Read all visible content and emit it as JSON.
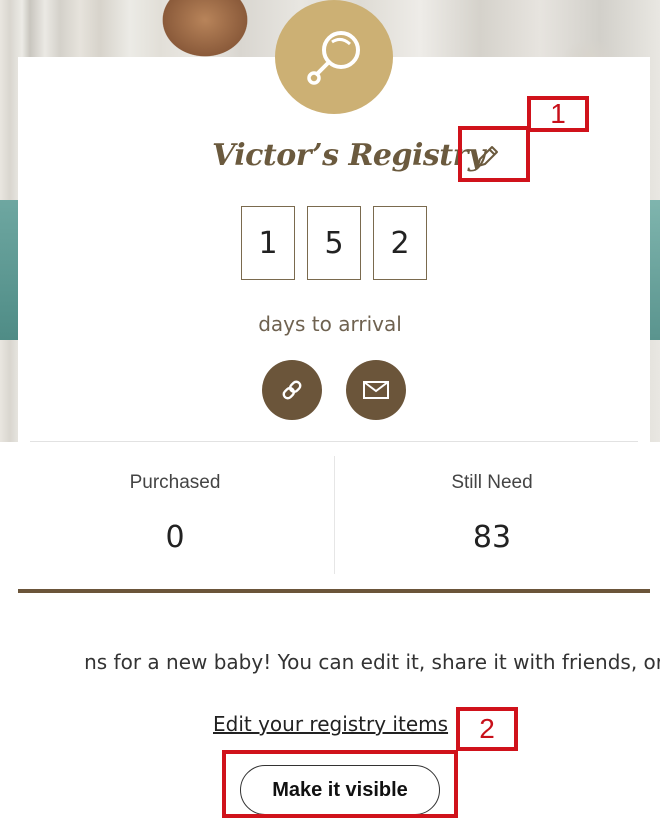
{
  "registry": {
    "title": "Victor’s Registry",
    "countdown_digits": [
      "1",
      "5",
      "2"
    ],
    "countdown_label": "days to arrival"
  },
  "stats": {
    "purchased_label": "Purchased",
    "purchased_value": "0",
    "still_need_label": "Still Need",
    "still_need_value": "83"
  },
  "intro_text": "ns for a new baby! You can edit it, share it with friends, or",
  "links": {
    "edit_items": "Edit your registry items"
  },
  "buttons": {
    "make_visible": "Make it visible"
  },
  "annotations": {
    "one": "1",
    "two": "2"
  },
  "icons": {
    "avatar": "rattle-icon",
    "edit": "pencil-icon",
    "share_link": "link-icon",
    "share_email": "envelope-icon"
  },
  "colors": {
    "brand_brown": "#6b553a",
    "title_brown": "#6b5a3e",
    "avatar_gold": "#ccb074",
    "annotation_red": "#d0121b"
  }
}
